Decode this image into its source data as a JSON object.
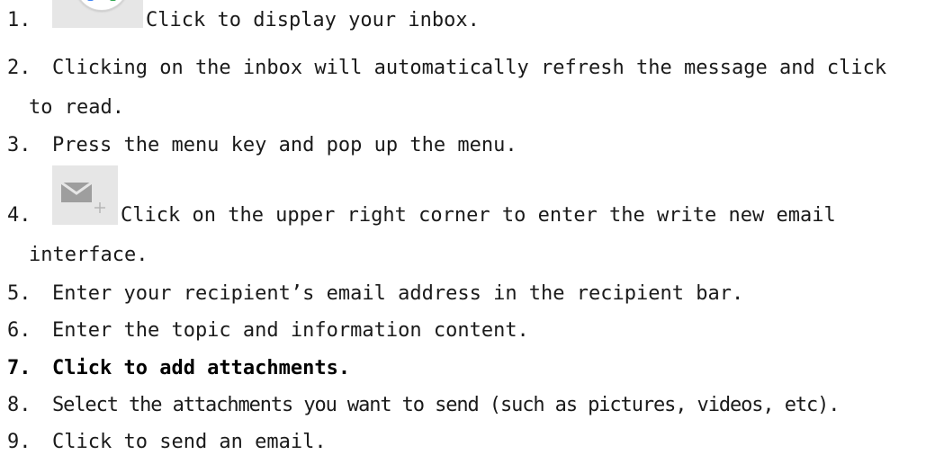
{
  "steps": [
    {
      "number": "1.",
      "text": "Click to display your inbox."
    },
    {
      "number": "2.",
      "text": "Clicking on the inbox will automatically refresh the message and click",
      "continuation": "to read."
    },
    {
      "number": "3.",
      "text": "Press the menu key and pop up the menu."
    },
    {
      "number": "4.",
      "text": "Click on the upper right corner to enter the write new email",
      "continuation": "interface."
    },
    {
      "number": "5.",
      "text": "Enter your recipient’s email address in the recipient bar."
    },
    {
      "number": "6.",
      "text": "Enter the topic and information content."
    },
    {
      "number": "7.",
      "text": "Click to add attachments."
    },
    {
      "number": "8.",
      "text": "Select the attachments you want to send (such as pictures, videos, etc)."
    },
    {
      "number": "9.",
      "text": "Click to send an email."
    }
  ],
  "icons": {
    "step1": "gmail-app-icon",
    "step4": "compose-email-icon"
  },
  "colors": {
    "text": "#1a1a1a",
    "icon_tile_bg": "#e6e6e6",
    "gmail_blue": "#4285f4",
    "gmail_green": "#34a853",
    "compose_icon": "#9e9e9e"
  }
}
